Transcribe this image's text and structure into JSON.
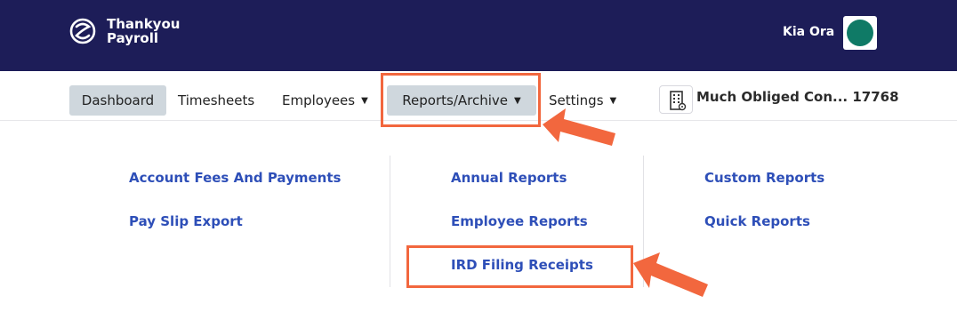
{
  "header": {
    "logo_line1": "Thankyou",
    "logo_line2": "Payroll",
    "greeting": "Kia Ora",
    "bg_color": "#1d1d58",
    "avatar_color": "#0f7a66"
  },
  "nav": {
    "dashboard": "Dashboard",
    "timesheets": "Timesheets",
    "employees": "Employees",
    "reports": "Reports/Archive",
    "settings": "Settings",
    "caret": "▼",
    "company": "Much Obliged Con... 17768"
  },
  "menu": {
    "col1": [
      "Account Fees And Payments",
      "Pay Slip Export"
    ],
    "col2": [
      "Annual Reports",
      "Employee Reports",
      "IRD Filing Receipts"
    ],
    "col3": [
      "Custom Reports",
      "Quick Reports"
    ],
    "link_color": "#2e4fb8"
  },
  "annotations": {
    "highlight_color": "#f2673e",
    "icons": [
      "logo-icon",
      "building-icon",
      "arrow-pointer-icon"
    ]
  }
}
